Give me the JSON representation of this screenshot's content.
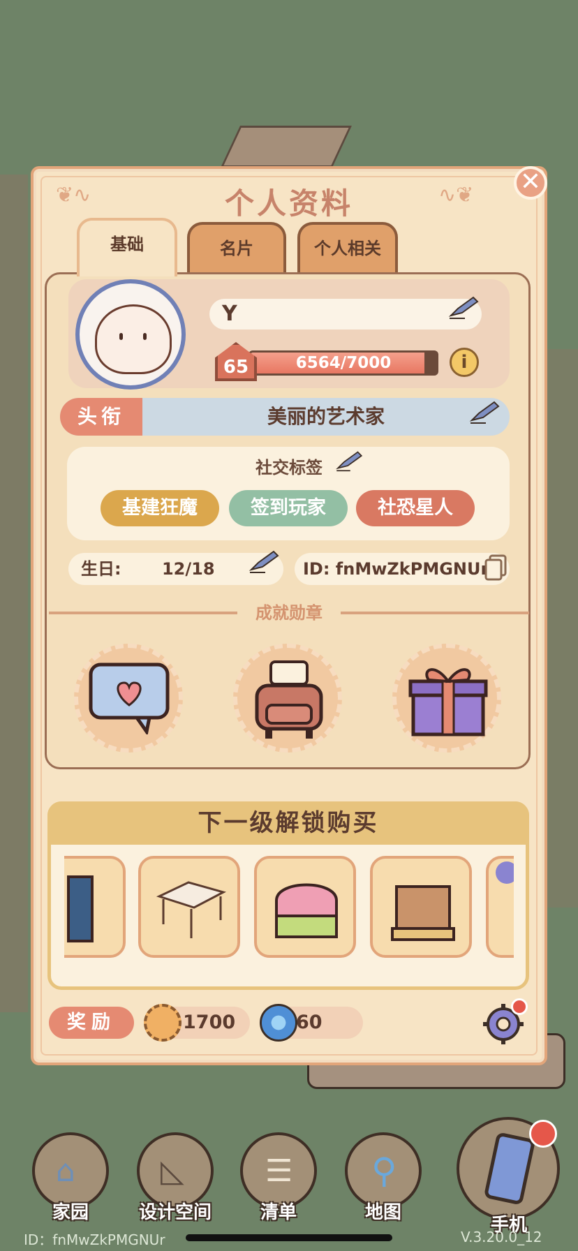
{
  "panel": {
    "title": "个人资料",
    "close_icon": "close-icon"
  },
  "tabs": [
    {
      "label": "基础",
      "active": true
    },
    {
      "label": "名片",
      "active": false
    },
    {
      "label": "个人相关",
      "active": false
    }
  ],
  "profile": {
    "name": "Y",
    "level": "65",
    "xp_text": "6564/7000",
    "xp_fraction": 0.9377,
    "title_label": "头衔",
    "title_value": "美丽的艺术家",
    "social_tags_title": "社交标签",
    "social_tags": [
      {
        "label": "基建狂魔",
        "color": "#dba74d"
      },
      {
        "label": "签到玩家",
        "color": "#93bfa4"
      },
      {
        "label": "社恐星人",
        "color": "#d97962"
      }
    ],
    "birthday_label": "生日:",
    "birthday_value": "12/18",
    "id_text": "ID: fnMwZkPMGNUr"
  },
  "achievements": {
    "title": "成就勋章",
    "badges": [
      "chat-heart-badge",
      "armchair-badge",
      "gift-box-badge"
    ]
  },
  "unlock": {
    "title": "下一级解锁购买",
    "items": [
      "framed-painting",
      "white-table",
      "pink-cabinet",
      "wooden-rack",
      "next-item"
    ]
  },
  "rewards": {
    "label": "奖励",
    "coin_amount": "1700",
    "gem_amount": "60"
  },
  "nav": [
    {
      "label": "家园",
      "icon": "home-icon"
    },
    {
      "label": "设计空间",
      "icon": "design-ruler-icon"
    },
    {
      "label": "清单",
      "icon": "list-scroll-icon"
    },
    {
      "label": "地图",
      "icon": "map-pin-icon"
    },
    {
      "label": "手机",
      "icon": "phone-icon"
    }
  ],
  "footer": {
    "id": "ID：fnMwZkPMGNUr",
    "version": "V.3.20.0_12"
  },
  "colors": {
    "accent": "#e58a72",
    "panel_bg": "#f7e4c5",
    "title_color": "#c7836a"
  }
}
